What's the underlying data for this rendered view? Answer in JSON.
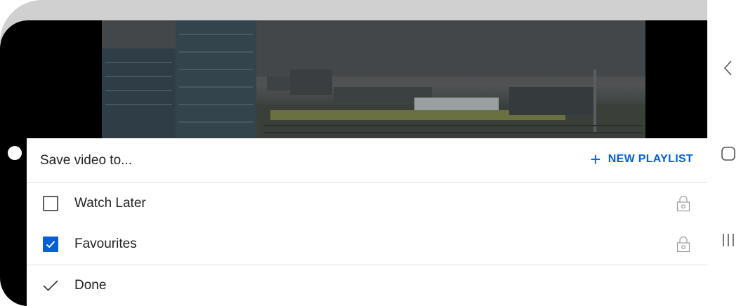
{
  "sheet": {
    "title": "Save video to...",
    "new_playlist_label": "NEW PLAYLIST",
    "accent_color": "#065fd4",
    "playlists": [
      {
        "label": "Watch Later",
        "checked": false,
        "icon": "lock-icon"
      },
      {
        "label": "Favourites",
        "checked": true,
        "icon": "lock-icon"
      }
    ],
    "done_label": "Done"
  },
  "nav_bar": {
    "icons": [
      "back-icon",
      "home-icon",
      "recents-icon"
    ]
  }
}
